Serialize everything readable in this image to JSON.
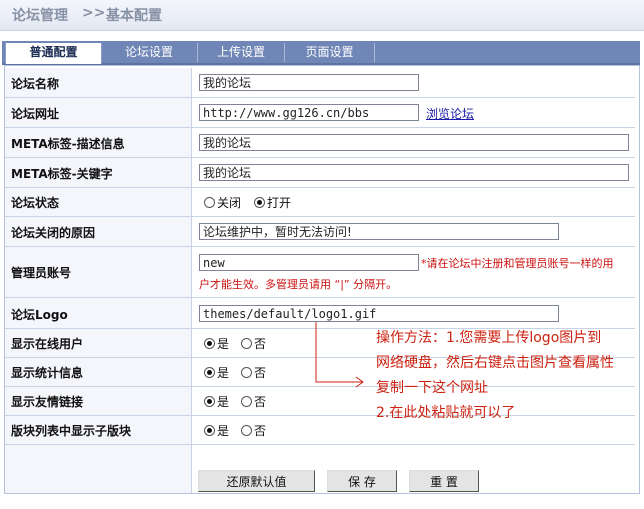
{
  "breadcrumb": {
    "section": "论坛管理",
    "separator": ">>",
    "page": "基本配置"
  },
  "tabs": [
    {
      "label": "普通配置",
      "active": true
    },
    {
      "label": "论坛设置",
      "active": false
    },
    {
      "label": "上传设置",
      "active": false
    },
    {
      "label": "页面设置",
      "active": false
    }
  ],
  "fields": {
    "forum_name": {
      "label": "论坛名称",
      "value": "我的论坛"
    },
    "forum_url": {
      "label": "论坛网址",
      "value": "http://www.gg126.cn/bbs",
      "link": "浏览论坛"
    },
    "meta_desc": {
      "label": "META标签-描述信息",
      "value": "我的论坛"
    },
    "meta_keywords": {
      "label": "META标签-关键字",
      "value": "我的论坛"
    },
    "forum_status": {
      "label": "论坛状态",
      "options": [
        "关闭",
        "打开"
      ],
      "selected": "打开"
    },
    "close_reason": {
      "label": "论坛关闭的原因",
      "value": "论坛维护中，暂时无法访问!"
    },
    "admin_account": {
      "label": "管理员账号",
      "value": "new",
      "note_line1": "*请在论坛中注册和管理员账号一样的用",
      "note_line2": "户才能生效。多管理员请用 “|” 分隔开。"
    },
    "forum_logo": {
      "label": "论坛Logo",
      "value": "themes/default/logo1.gif"
    },
    "show_online": {
      "label": "显示在线用户",
      "options": [
        "是",
        "否"
      ],
      "selected": "是"
    },
    "show_stats": {
      "label": "显示统计信息",
      "options": [
        "是",
        "否"
      ],
      "selected": "是"
    },
    "show_links": {
      "label": "显示友情链接",
      "options": [
        "是",
        "否"
      ],
      "selected": "是"
    },
    "show_subforums": {
      "label": "版块列表中显示子版块",
      "options": [
        "是",
        "否"
      ],
      "selected": "是"
    }
  },
  "annotation": {
    "line1": "操作方法：1.您需要上传logo图片到",
    "line2": "网络硬盘，然后右键点击图片查看属性",
    "line3": "复制一下这个网址",
    "line4": "2.在此处粘贴就可以了"
  },
  "buttons": {
    "reset": "还原默认值",
    "save": "保 存",
    "clear": "重 置"
  },
  "colors": {
    "tab_bar": "#6f86b6",
    "label_bg": "#f4f6fb",
    "annotation": "#cc2211"
  }
}
